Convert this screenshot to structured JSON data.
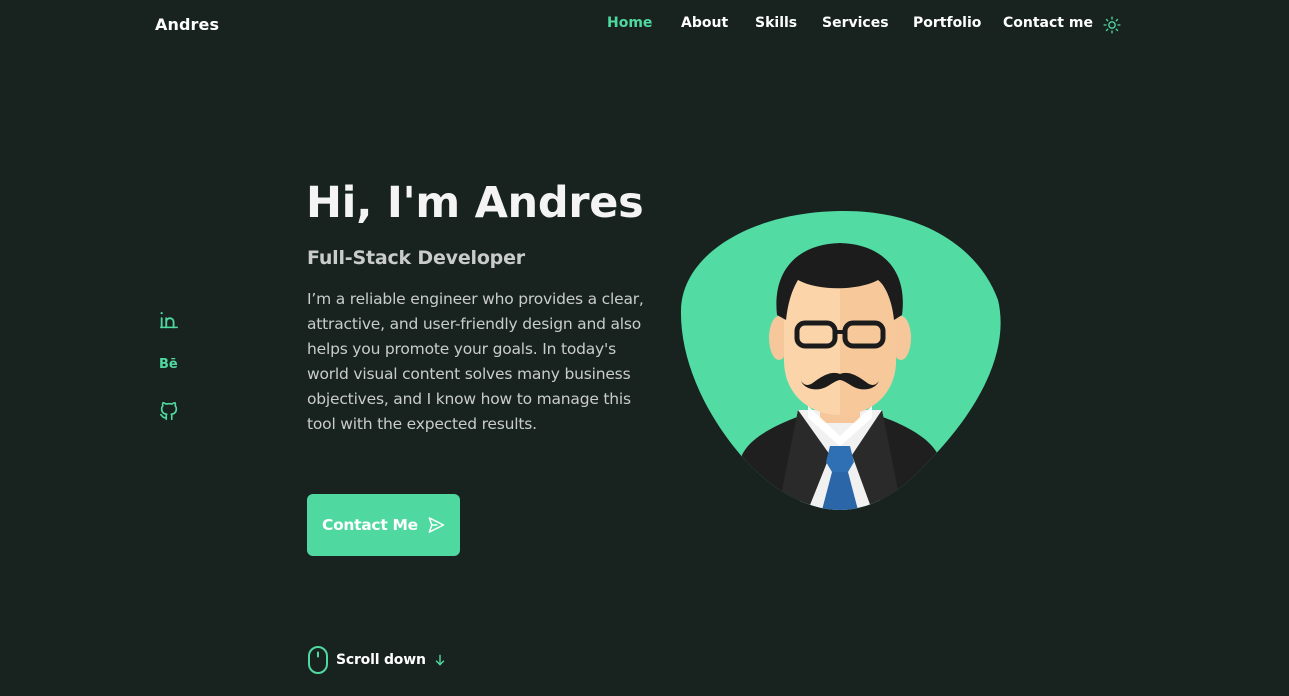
{
  "header": {
    "logo": "Andres",
    "nav": [
      {
        "label": "Home",
        "active": true
      },
      {
        "label": "About",
        "active": false
      },
      {
        "label": "Skills",
        "active": false
      },
      {
        "label": "Services",
        "active": false
      },
      {
        "label": "Portfolio",
        "active": false
      },
      {
        "label": "Contact me",
        "active": false
      }
    ],
    "theme_toggle_icon": "sun-icon"
  },
  "social": [
    {
      "name": "linkedin",
      "icon": "linkedin-icon"
    },
    {
      "name": "behance",
      "icon": "behance-icon",
      "glyph": "Bē"
    },
    {
      "name": "github",
      "icon": "github-icon"
    }
  ],
  "hero": {
    "title": "Hi, I'm Andres",
    "subtitle": "Full-Stack Developer",
    "description": "I’m a reliable engineer who provides a clear, attractive, and user-friendly design and also helps you promote your goals. In today's world visual content solves many business objectives, and I know how to manage this tool with the expected results.",
    "cta_label": "Contact Me",
    "cta_icon": "send-icon",
    "scroll_label": "Scroll down",
    "scroll_icon": "mouse-icon",
    "scroll_arrow_icon": "arrow-down-icon",
    "avatar_icon": "developer-avatar-illustration"
  },
  "colors": {
    "background": "#182320",
    "accent": "#4fd9a0",
    "title": "#f4f4f4",
    "text": "#c9ccca"
  }
}
